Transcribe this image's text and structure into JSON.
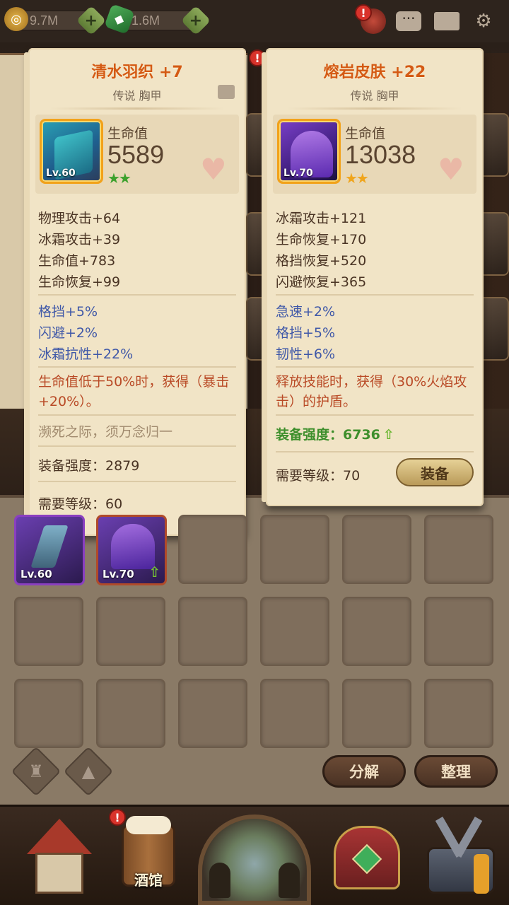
{
  "topbar": {
    "gold_value": "9.7M",
    "gem_value": "1.6M"
  },
  "card_left": {
    "title": "清水羽织 +7",
    "subtitle": "传说 胸甲",
    "level": "Lv.60",
    "main_stat_name": "生命值",
    "main_stat_value": "5589",
    "star_count": 2,
    "star_color": "#3da12d",
    "base_stats": [
      "物理攻击+64",
      "冰霜攻击+39",
      "生命值+783",
      "生命恢复+99"
    ],
    "sub_stats": [
      "格挡+5%",
      "闪避+2%",
      "冰霜抗性+22%"
    ],
    "effect": "生命值低于50%时，获得（暴击+20%）。",
    "flavor": "濒死之际，须万念归一",
    "power_label": "装备强度：2879",
    "required_level": "需要等级：60"
  },
  "card_right": {
    "title": "熔岩皮肤 +22",
    "subtitle": "传说 胸甲",
    "level": "Lv.70",
    "main_stat_name": "生命值",
    "main_stat_value": "13038",
    "star_count": 2,
    "star_color": "#f0a51c",
    "base_stats": [
      "冰霜攻击+121",
      "生命恢复+170",
      "格挡恢复+520",
      "闪避恢复+365"
    ],
    "sub_stats": [
      "急速+2%",
      "格挡+5%",
      "韧性+6%"
    ],
    "effect": "释放技能时，获得（30%火焰攻击）的护盾。",
    "power_label": "装备强度：6736",
    "required_level": "需要等级：70",
    "equip_label": "装备"
  },
  "inventory": {
    "items": [
      {
        "level": "Lv.60"
      },
      {
        "level": "Lv.70"
      }
    ],
    "decompose_label": "分解",
    "sort_label": "整理"
  },
  "bottom_nav": {
    "tavern_label": "酒馆"
  },
  "colors": {
    "title_orange": "#d45a14",
    "sub_stat_blue": "#3f58a8",
    "effect_red": "#b94a26",
    "power_green": "#3e8f2c"
  }
}
